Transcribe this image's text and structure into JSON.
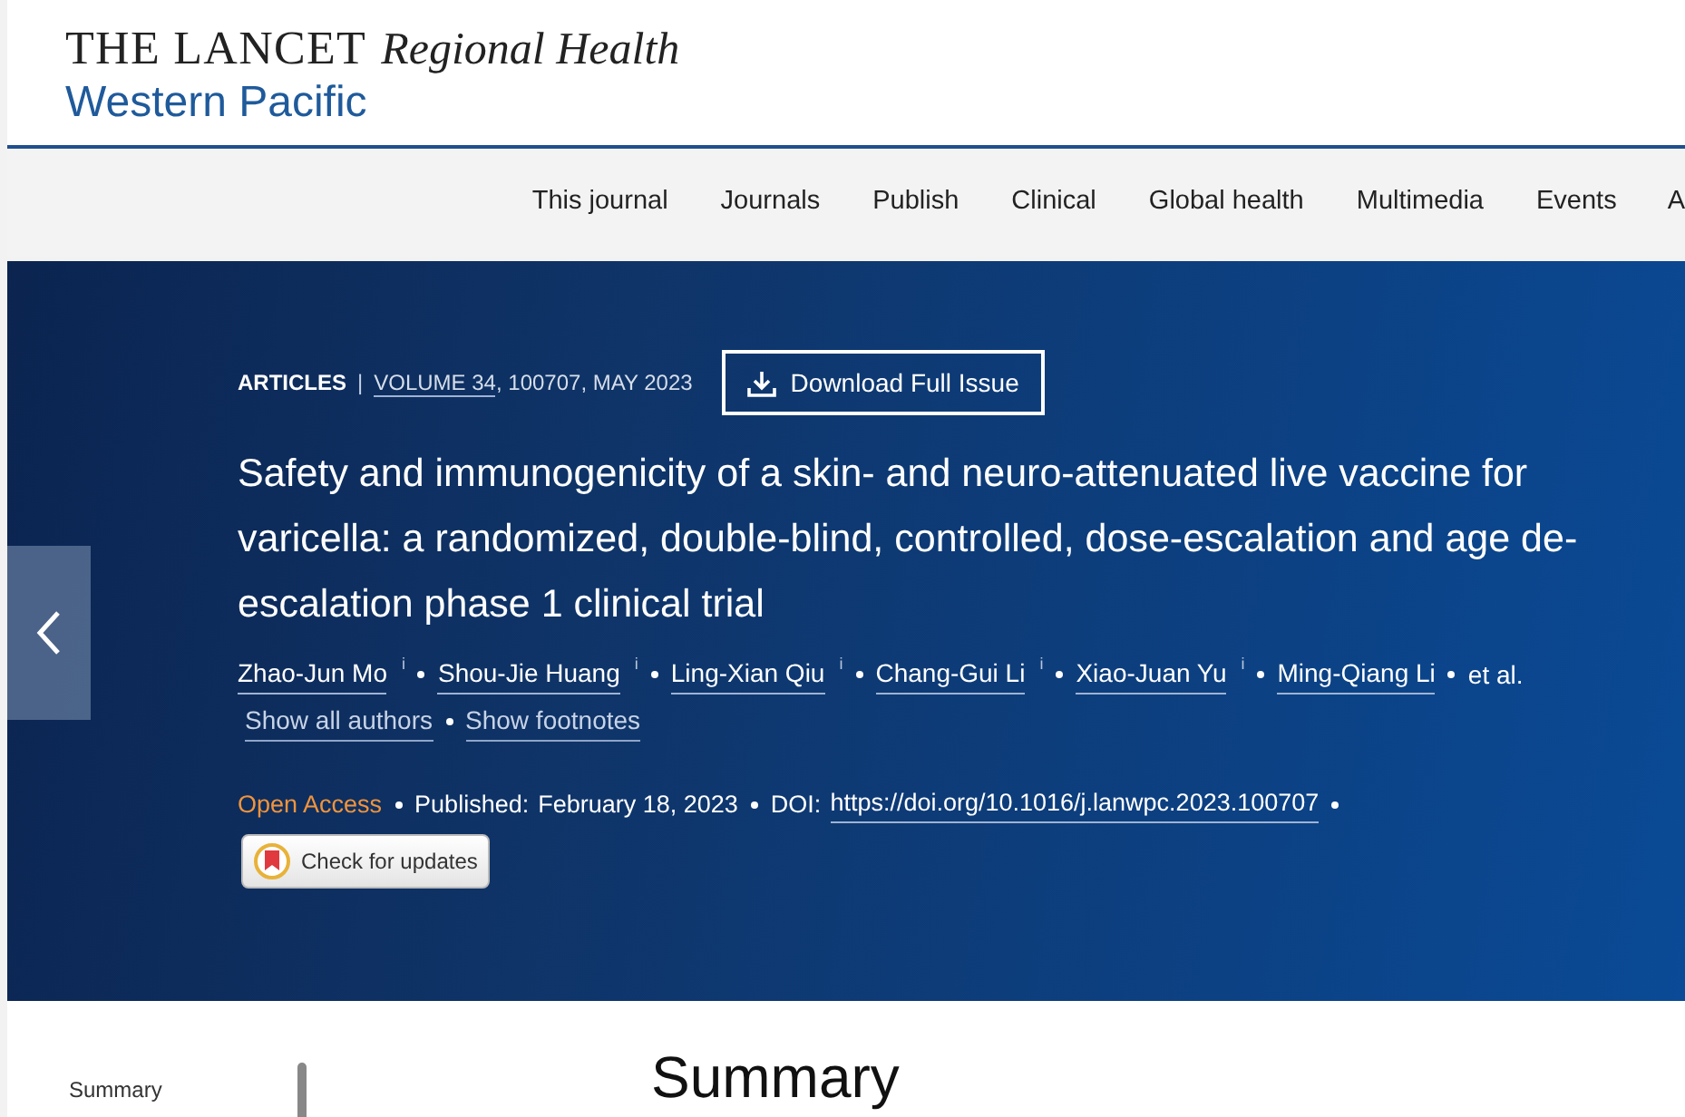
{
  "logo": {
    "brand": "THE LANCET",
    "title": "Regional Health",
    "subtitle": "Western Pacific"
  },
  "nav": [
    {
      "label": "This journal"
    },
    {
      "label": "Journals"
    },
    {
      "label": "Publish"
    },
    {
      "label": "Clinical"
    },
    {
      "label": "Global health"
    },
    {
      "label": "Multimedia"
    },
    {
      "label": "Events"
    },
    {
      "label": "A"
    }
  ],
  "article": {
    "type": "ARTICLES",
    "separator": "|",
    "volume": "VOLUME 34",
    "issue": ", 100707, MAY 2023",
    "download": "Download Full Issue",
    "title": "Safety and immunogenicity of a skin- and neuro-attenuated live vaccine for varicella: a randomized, double-blind, controlled, dose-escalation and age de-escalation phase 1 clinical trial",
    "authors": [
      {
        "name": "Zhao-Jun Mo",
        "info": "i"
      },
      {
        "name": "Shou-Jie Huang",
        "info": "i"
      },
      {
        "name": "Ling-Xian Qiu",
        "info": "i"
      },
      {
        "name": "Chang-Gui Li",
        "info": "i"
      },
      {
        "name": "Xiao-Juan Yu",
        "info": "i"
      },
      {
        "name": "Ming-Qiang Li"
      }
    ],
    "et_al": "et al.",
    "links": [
      "Show all authors",
      "Show footnotes"
    ],
    "access": "Open Access",
    "published_label": "Published:",
    "published": "February 18, 2023",
    "doi_label": "DOI:",
    "doi": "https://doi.org/10.1016/j.lanwpc.2023.100707",
    "check_updates": "Check for updates"
  },
  "sidebar": {
    "items": [
      {
        "label": "Summary"
      }
    ]
  },
  "section_title": "Summary"
}
